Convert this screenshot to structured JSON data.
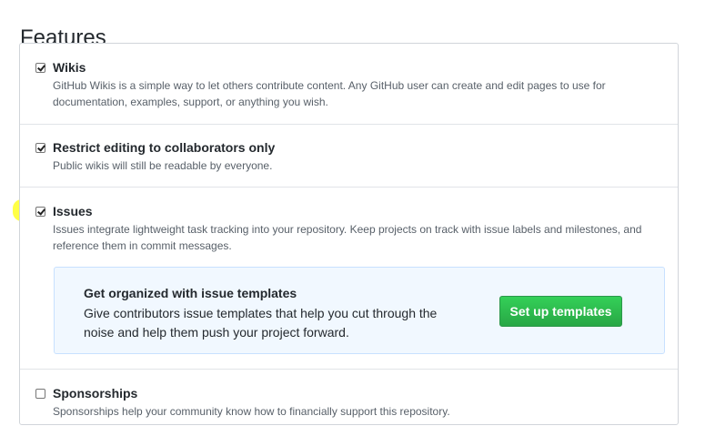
{
  "page": {
    "title": "Features"
  },
  "features": [
    {
      "label": "Wikis",
      "checked": true,
      "description": "GitHub Wikis is a simple way to let others contribute content. Any GitHub user can create and edit pages to use for documentation, examples, support, or anything you wish."
    },
    {
      "label": "Restrict editing to collaborators only",
      "checked": true,
      "description": "Public wikis will still be readable by everyone."
    },
    {
      "label": "Issues",
      "checked": true,
      "highlighted": true,
      "description": "Issues integrate lightweight task tracking into your repository. Keep projects on track with issue labels and milestones, and reference them in commit messages."
    },
    {
      "label": "Sponsorships",
      "checked": false,
      "description": "Sponsorships help your community know how to financially support this repository."
    }
  ],
  "issue_templates": {
    "title": "Get organized with issue templates",
    "text": "Give contributors issue templates that help you cut through the noise and help them push your project forward.",
    "button_label": "Set up templates"
  },
  "colors": {
    "highlight": "#ffff3c",
    "button": "#28a745",
    "callout_bg": "#f1f8ff"
  }
}
